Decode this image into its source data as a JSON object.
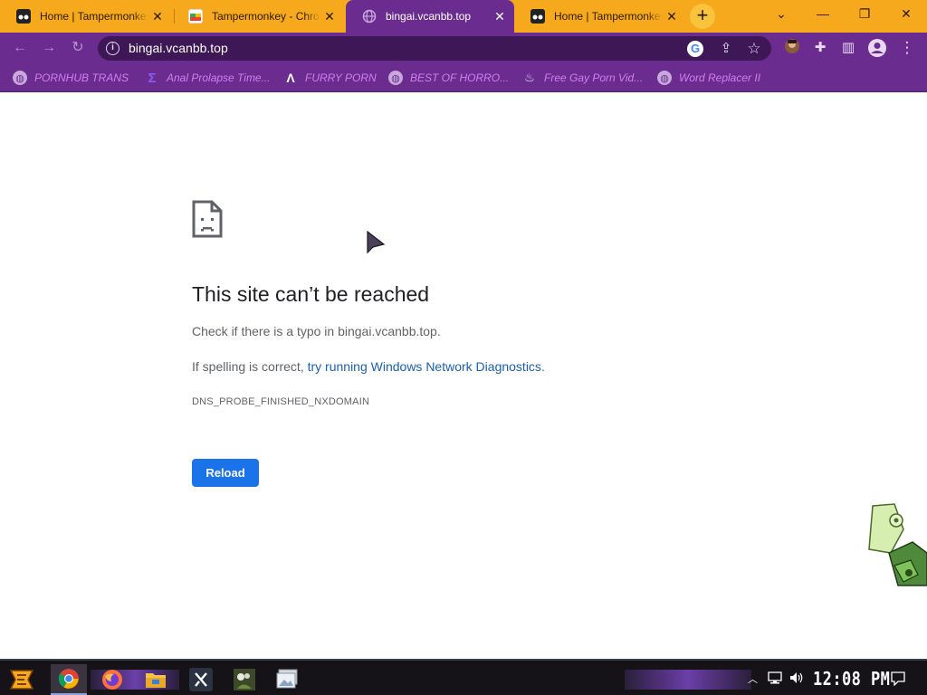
{
  "tabs": [
    {
      "title": "Home | Tampermonkey",
      "active": false
    },
    {
      "title": "Tampermonkey - Chrome Web Store",
      "active": false
    },
    {
      "title": "bingai.vcanbb.top",
      "active": true
    },
    {
      "title": "Home | Tampermonkey",
      "active": false
    }
  ],
  "tab_close_glyph": "✕",
  "new_tab_glyph": "+",
  "window_controls": {
    "menu": "⌄",
    "minimize": "—",
    "restore": "❐",
    "close": "✕"
  },
  "toolbar": {
    "back_glyph": "←",
    "forward_glyph": "→",
    "reload_glyph": "↻",
    "url": "bingai.vcanbb.top",
    "info_glyph": "i",
    "google_glyph": "G",
    "share_glyph": "⇪",
    "star_glyph": "☆",
    "extensions_glyph": "✚",
    "sidepanel_glyph": "▥",
    "menu_glyph": "⋮"
  },
  "bookmarks": [
    {
      "label": "PORNHUB TRANS",
      "icon": "globe-icon"
    },
    {
      "label": "Anal Prolapse Time...",
      "icon": "bookmark-icon"
    },
    {
      "label": "FURRY PORN",
      "icon": "a-logo-icon"
    },
    {
      "label": "BEST OF HORRO...",
      "icon": "globe-icon"
    },
    {
      "label": "Free Gay Porn Vid...",
      "icon": "site-icon"
    },
    {
      "label": "Word Replacer II",
      "icon": "globe-icon"
    }
  ],
  "error": {
    "title": "This site can’t be reached",
    "line1": "Check if there is a typo in bingai.vcanbb.top.",
    "line2_prefix": "If spelling is correct, ",
    "line2_link": "try running Windows Network Diagnostics",
    "line2_suffix": ".",
    "code": "DNS_PROBE_FINISHED_NXDOMAIN",
    "reload_label": "Reload"
  },
  "taskbar": {
    "clock": "12:08 PM"
  },
  "colors": {
    "tabstrip": "#f6a91c",
    "toolbar": "#6a2d8f",
    "reload_button": "#1a73e8",
    "link": "#1a5fb4"
  }
}
